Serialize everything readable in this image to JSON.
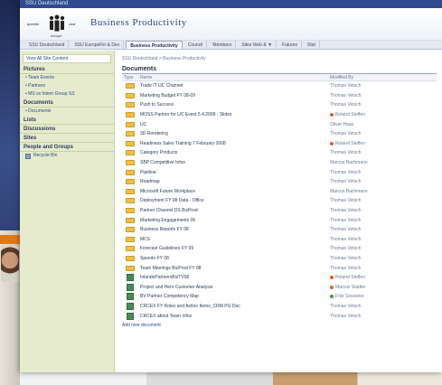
{
  "topbar": {
    "title": "SSU Deutschland"
  },
  "banner": {
    "logo_left": "quentin",
    "logo_right": "cost",
    "logo_sub": "europe",
    "site_title": "Business Productivity"
  },
  "topnav": {
    "tabs": [
      {
        "label": "SSU Deutschland"
      },
      {
        "label": "SSU EuropeFin & Dev"
      },
      {
        "label": "Business Productivity",
        "active": true
      },
      {
        "label": "Council"
      },
      {
        "label": "Members"
      },
      {
        "label": "Sites Web & ▼"
      },
      {
        "label": "Futures"
      },
      {
        "label": "Stat"
      }
    ]
  },
  "leftnav": {
    "view_all": "View All Site Content",
    "sections": [
      {
        "title": "Pictures",
        "items": [
          "Team Events",
          "Partners",
          "MS vs Intern Group SS"
        ]
      },
      {
        "title": "Documents",
        "items": [
          "Documents"
        ]
      },
      {
        "title": "Lists",
        "items": []
      },
      {
        "title": "Discussions",
        "items": []
      },
      {
        "title": "Sites",
        "items": []
      },
      {
        "title": "People and Groups",
        "items": []
      }
    ],
    "recycle_bin": "Recycle Bin"
  },
  "main": {
    "breadcrumb": "SSU Deutschland > Business Productivity",
    "section_title": "Documents",
    "col_type": "Type",
    "col_name": "Name",
    "col_modified": "Modified By",
    "rows": [
      {
        "icon": "folder",
        "name": "Trade IT UC Channel",
        "modified": "Thomas Vetsch",
        "presence": ""
      },
      {
        "icon": "folder",
        "name": "Marketing Budget FY 08-09",
        "modified": "Thomas Vetsch",
        "presence": ""
      },
      {
        "icon": "folder",
        "name": "Push to Success",
        "modified": "Thomas Vetsch",
        "presence": ""
      },
      {
        "icon": "folder",
        "name": "MOSS Partner for UC Event 5.4.2008 - Slides",
        "modified": "Roland Steffen",
        "presence": "#e06020"
      },
      {
        "icon": "folder",
        "name": "UC",
        "modified": "Oliver Haas",
        "presence": ""
      },
      {
        "icon": "folder",
        "name": "3D Rendering",
        "modified": "Thomas Vetsch",
        "presence": ""
      },
      {
        "icon": "folder",
        "name": "Readiness Sales Training 7 February 2008",
        "modified": "Roland Steffen",
        "presence": "#e06020"
      },
      {
        "icon": "folder",
        "name": "Category Products",
        "modified": "Thomas Vetsch",
        "presence": ""
      },
      {
        "icon": "folder",
        "name": "SBP Competitive Infos",
        "modified": "Marcus Bachmann",
        "presence": ""
      },
      {
        "icon": "folder",
        "name": "Pipeline",
        "modified": "Thomas Vetsch",
        "presence": ""
      },
      {
        "icon": "folder",
        "name": "Roadmap",
        "modified": "Thomas Vetsch",
        "presence": ""
      },
      {
        "icon": "folder",
        "name": "Microsoft Future Workplace",
        "modified": "Marcus Bachmann",
        "presence": ""
      },
      {
        "icon": "folder",
        "name": "Deployment FY 08 Data - Office",
        "modified": "Thomas Vetsch",
        "presence": ""
      },
      {
        "icon": "folder",
        "name": "Partner Channel DS BizProd",
        "modified": "Thomas Vetsch",
        "presence": ""
      },
      {
        "icon": "folder",
        "name": "Marketing Engagements 06",
        "modified": "Thomas Vetsch",
        "presence": ""
      },
      {
        "icon": "folder",
        "name": "Business Reports FY 08",
        "modified": "Thomas Vetsch",
        "presence": ""
      },
      {
        "icon": "folder",
        "name": "MCS",
        "modified": "Thomas Vetsch",
        "presence": ""
      },
      {
        "icon": "folder",
        "name": "Forecast Guidelines FY 09",
        "modified": "Thomas Vetsch",
        "presence": ""
      },
      {
        "icon": "folder",
        "name": "Speedo FY 08",
        "modified": "Thomas Vetsch",
        "presence": ""
      },
      {
        "icon": "folder",
        "name": "Team Meetings BizProd FY 08",
        "modified": "Thomas Vetsch",
        "presence": ""
      },
      {
        "icon": "doc",
        "name": "InlandePartnersBizTV08",
        "modified": "Roland Steffen",
        "presence": "#e06020"
      },
      {
        "icon": "doc",
        "name": "Project and Hero Customer Analysis",
        "modified": "Marcus Stadler",
        "presence": "#e06020"
      },
      {
        "icon": "doc",
        "name": "BV Partner Competency Map",
        "modified": "Fritz Grossner",
        "presence": "#40a040"
      },
      {
        "icon": "doc",
        "name": "CRCEX FY Roles and Action Items_CRM PG Doc",
        "modified": "Thomas Vetsch",
        "presence": ""
      },
      {
        "icon": "doc",
        "name": "CRCEX about Team Infos",
        "modified": "Thomas Vetsch",
        "presence": ""
      }
    ],
    "add_link": "Add new document"
  },
  "colors": {
    "topbar": "#2f4a8f",
    "leftnav_bg": "#e6ebce",
    "link": "#2a4a8a"
  }
}
